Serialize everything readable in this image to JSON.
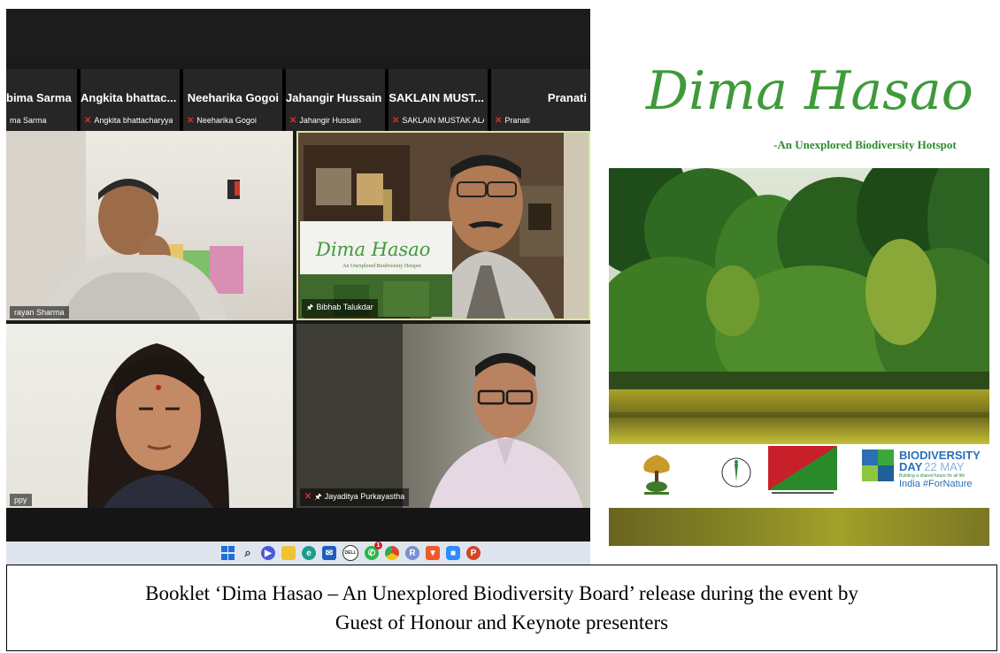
{
  "zoom": {
    "strip": [
      {
        "name": "bima Sarma",
        "tag": "ma Sarma",
        "muted": false
      },
      {
        "name": "Angkita  bhattac...",
        "tag": "Angkita bhattacharyya",
        "muted": true
      },
      {
        "name": "Neeharika Gogoi",
        "tag": "Neeharika Gogoi",
        "muted": true
      },
      {
        "name": "Jahangir Hussain",
        "tag": "Jahangir Hussain",
        "muted": true
      },
      {
        "name": "SAKLAIN MUST...",
        "tag": "SAKLAIN MUSTAK ALA...",
        "muted": true
      },
      {
        "name": "Pranati",
        "tag": "Pranati",
        "muted": true
      }
    ],
    "videos": [
      {
        "label": "rayan Sharma"
      },
      {
        "label": "Bibhab Talukdar",
        "booklet_title": "Dima Hasao",
        "booklet_sub": "An Unexplored Biodiversity Hotspot"
      },
      {
        "label": "ppy"
      },
      {
        "label": "Jayaditya Purkayastha"
      }
    ],
    "colors": {
      "mic_muted": "#e02a2a",
      "speaker_border": "#d6e89a"
    }
  },
  "taskbar": {
    "icons": [
      "windows-start-icon",
      "search-icon",
      "meet-icon",
      "file-explorer-icon",
      "edge-icon",
      "mail-icon",
      "dell-icon",
      "whatsapp-icon",
      "chrome-icon",
      "r-icon",
      "brave-icon",
      "zoom-icon",
      "powerpoint-icon"
    ],
    "whatsapp_badge": "1"
  },
  "poster": {
    "title": "Dima Hasao",
    "subtitle": "-An Unexplored Biodiversity Hotspot",
    "badge": {
      "line1": "BIODIVERSITY",
      "line2a": "DAY",
      "line2b": "22 MAY",
      "line3": "Building a shared future for all life",
      "line4": "India #ForNature"
    },
    "colors": {
      "title": "#3f9a3a",
      "badge_blue": "#2b6fb8",
      "badge_green": "#3aa83a"
    }
  },
  "caption": {
    "line1": "Booklet ‘Dima Hasao – An Unexplored Biodiversity Board’ release during the event by",
    "line2": "Guest of Honour and Keynote presenters"
  }
}
